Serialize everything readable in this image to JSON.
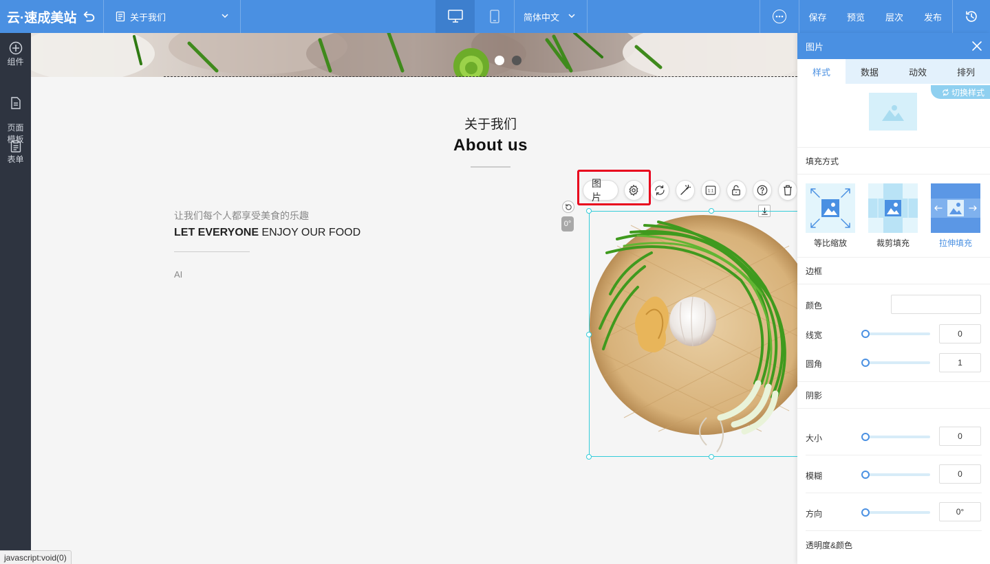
{
  "app": {
    "logo": "云·速成美站",
    "page_name": "关于我们",
    "language": "简体中文",
    "actions": {
      "save": "保存",
      "preview": "预览",
      "layers": "层次",
      "publish": "发布"
    }
  },
  "sidebar": {
    "items": [
      {
        "label": "组件",
        "icon": "plus-circle-icon"
      },
      {
        "label": "页面\n模板",
        "icon": "page-icon"
      },
      {
        "label": "表单",
        "icon": "clipboard-icon"
      }
    ]
  },
  "canvas": {
    "title_cn": "关于我们",
    "title_en": "About us",
    "slogan_cn": "让我们每个人都享受美食的乐趣",
    "slogan_en_bold": "LET EVERYONE",
    "slogan_en_rest": " ENJOY OUR FOOD",
    "body_text": "AI",
    "angle": "0°"
  },
  "float_toolbar": {
    "label": "图片",
    "icons": [
      "gear-icon",
      "refresh-icon",
      "magic-wand-icon",
      "ratio-icon",
      "lock-icon",
      "help-icon",
      "trash-icon"
    ],
    "ratio_text": "1:1"
  },
  "panel": {
    "title": "图片",
    "tabs": [
      "样式",
      "数据",
      "动效",
      "排列"
    ],
    "active_tab": 0,
    "switch_style": "切换样式",
    "fill_section": "填充方式",
    "fill_options": [
      "等比缩放",
      "裁剪填充",
      "拉伸填充"
    ],
    "fill_active": 2,
    "border_section": "边框",
    "border": {
      "color_label": "颜色",
      "width_label": "线宽",
      "width_value": "0",
      "radius_label": "圆角",
      "radius_value": "1"
    },
    "shadow_section": "阴影",
    "shadow": {
      "size_label": "大小",
      "size_value": "0",
      "blur_label": "模糊",
      "blur_value": "0",
      "direction_label": "方向",
      "direction_value": "0°",
      "opacity_label": "透明度&颜色"
    }
  },
  "status_bar": "javascript:void(0)",
  "colors": {
    "topbar": "#4a90e2",
    "sidebar": "#2e3440",
    "highlight": "#e8001c",
    "selection": "#33ccd9"
  }
}
